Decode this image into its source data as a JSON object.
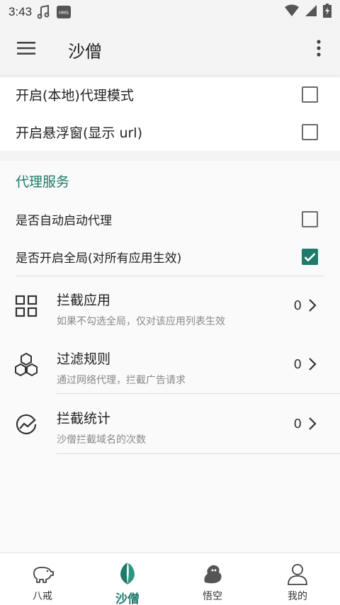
{
  "status_bar": {
    "time": "3:43",
    "hms_label": "HMS"
  },
  "app_bar": {
    "title": "沙僧"
  },
  "top_options": [
    {
      "label": "开启(本地)代理模式",
      "checked": false
    },
    {
      "label": "开启悬浮窗(显示 url)",
      "checked": false
    }
  ],
  "proxy_section": {
    "title": "代理服务",
    "options": [
      {
        "label": "是否自动启动代理",
        "checked": false
      },
      {
        "label": "是否开启全局(对所有应用生效)",
        "checked": true
      }
    ],
    "entries": [
      {
        "title": "拦截应用",
        "subtitle": "如果不勾选全局，仅对该应用列表生效",
        "count": "0",
        "icon": "grid-icon"
      },
      {
        "title": "过滤规则",
        "subtitle": "通过网络代理，拦截广告请求",
        "count": "0",
        "icon": "hexagons-icon"
      },
      {
        "title": "拦截统计",
        "subtitle": "沙僧拦截域名的次数",
        "count": "0",
        "icon": "stats-icon"
      }
    ]
  },
  "bottom_nav": {
    "tabs": [
      {
        "label": "八戒",
        "icon": "pig-icon",
        "active": false
      },
      {
        "label": "沙僧",
        "icon": "leaf-icon",
        "active": true
      },
      {
        "label": "悟空",
        "icon": "monkey-icon",
        "active": false
      },
      {
        "label": "我的",
        "icon": "person-icon",
        "active": false
      }
    ]
  },
  "colors": {
    "accent": "#1f7a6b",
    "background": "#f4f4f4",
    "card": "#ffffff"
  }
}
